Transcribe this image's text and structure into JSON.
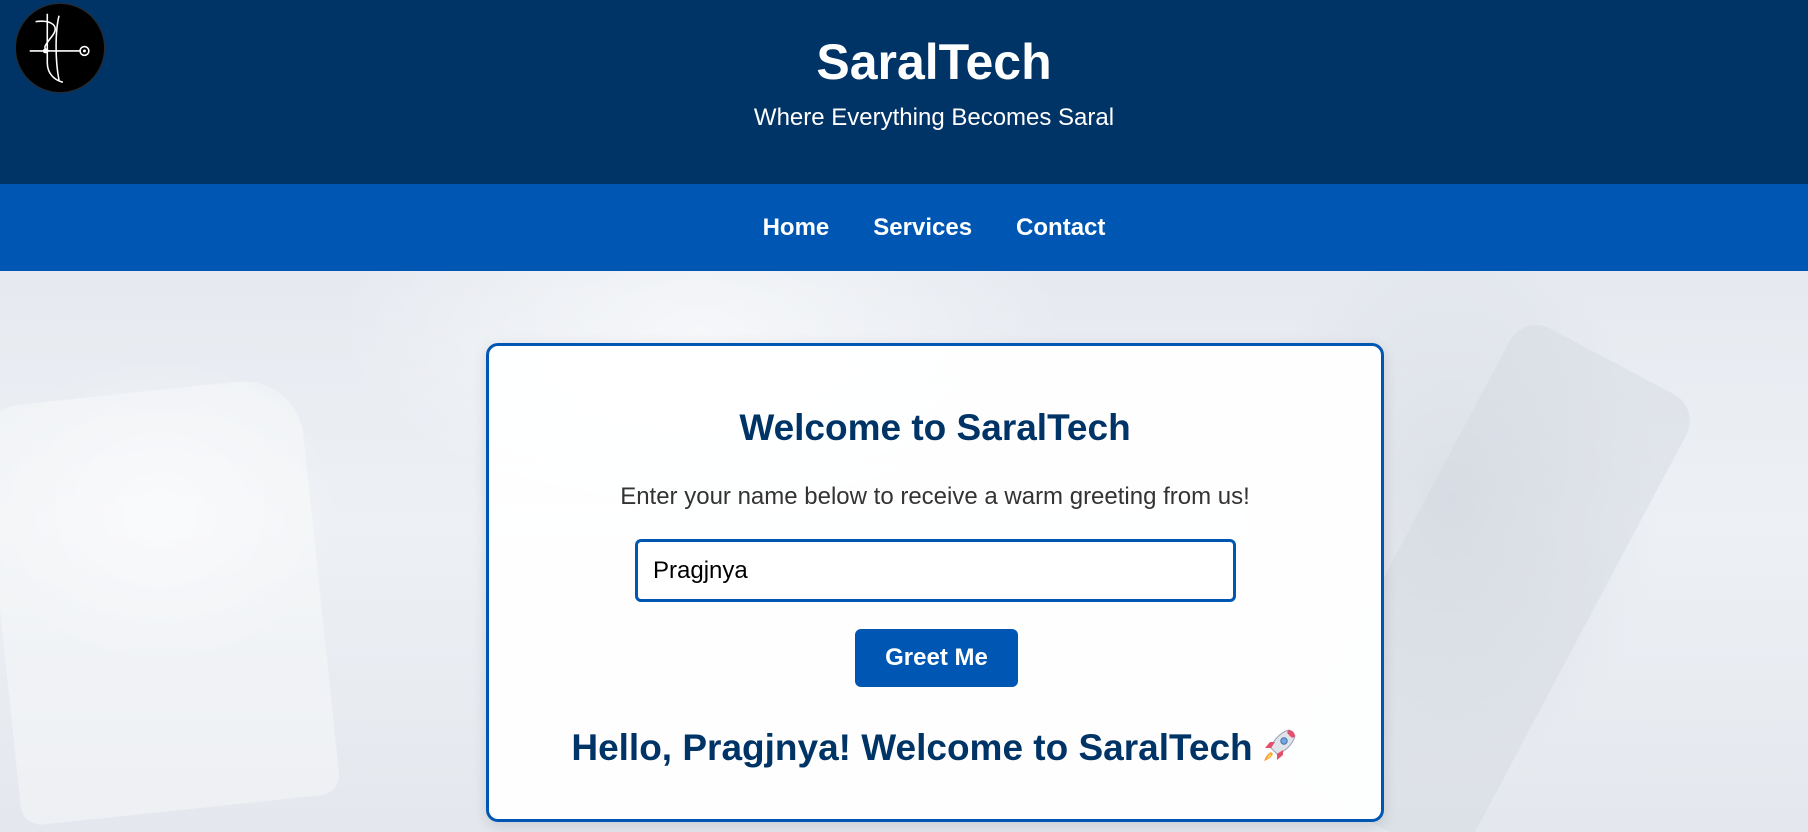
{
  "header": {
    "title": "SaralTech",
    "tagline": "Where Everything Becomes Saral",
    "logo_icon": "saraltech-logo-icon"
  },
  "nav": {
    "items": [
      {
        "label": "Home"
      },
      {
        "label": "Services"
      },
      {
        "label": "Contact"
      }
    ]
  },
  "card": {
    "title": "Welcome to SaralTech",
    "description": "Enter your name below to receive a warm greeting from us!",
    "name_input_value": "Pragjnya",
    "button_label": "Greet Me",
    "greeting": "Hello, Pragjnya! Welcome to SaralTech",
    "greeting_icon": "rocket-icon"
  },
  "colors": {
    "header_bg": "#003366",
    "nav_bg": "#0057b3",
    "accent": "#0057b3",
    "heading_text": "#003366"
  }
}
